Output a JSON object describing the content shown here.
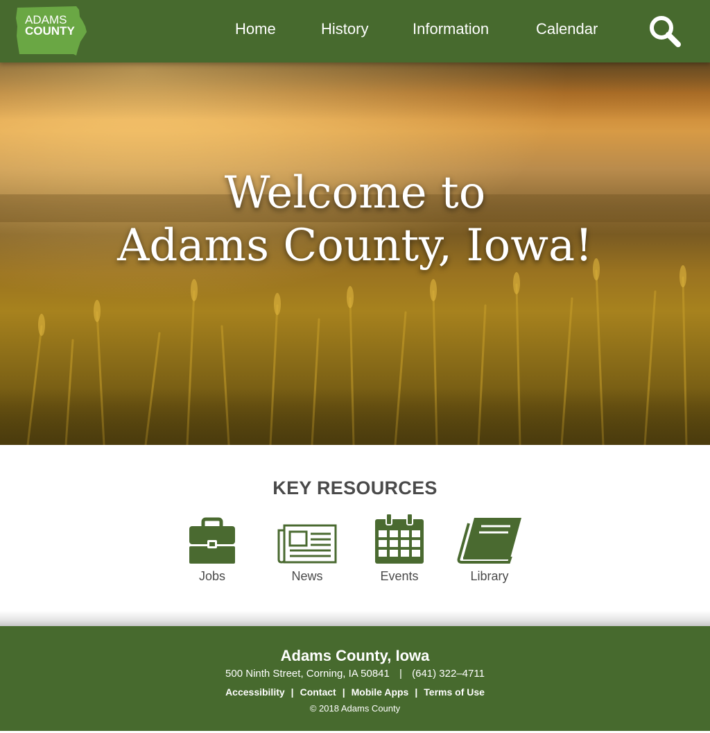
{
  "header": {
    "logo": {
      "line1": "ADAMS",
      "line2": "COUNTY"
    },
    "nav": [
      {
        "label": "Home"
      },
      {
        "label": "History"
      },
      {
        "label": "Information"
      },
      {
        "label": "Calendar"
      }
    ],
    "search_icon": "search-icon"
  },
  "hero": {
    "line1": "Welcome to",
    "line2": "Adams County, Iowa!"
  },
  "resources": {
    "title": "KEY RESOURCES",
    "items": [
      {
        "label": "Jobs",
        "icon": "briefcase-icon"
      },
      {
        "label": "News",
        "icon": "newspaper-icon"
      },
      {
        "label": "Events",
        "icon": "calendar-icon"
      },
      {
        "label": "Library",
        "icon": "book-icon"
      }
    ]
  },
  "footer": {
    "name": "Adams County, Iowa",
    "address": "500 Ninth Street, Corning, IA 50841",
    "phone": "(641) 322–4711",
    "links": [
      {
        "label": "Accessibility"
      },
      {
        "label": "Contact"
      },
      {
        "label": "Mobile Apps"
      },
      {
        "label": "Terms of Use"
      }
    ],
    "copyright": "© 2018 Adams County"
  },
  "colors": {
    "brand_green": "#476a2e",
    "logo_green": "#6aa744",
    "heading_gray": "#4a4a4a",
    "icon_green": "#4a6a30"
  }
}
